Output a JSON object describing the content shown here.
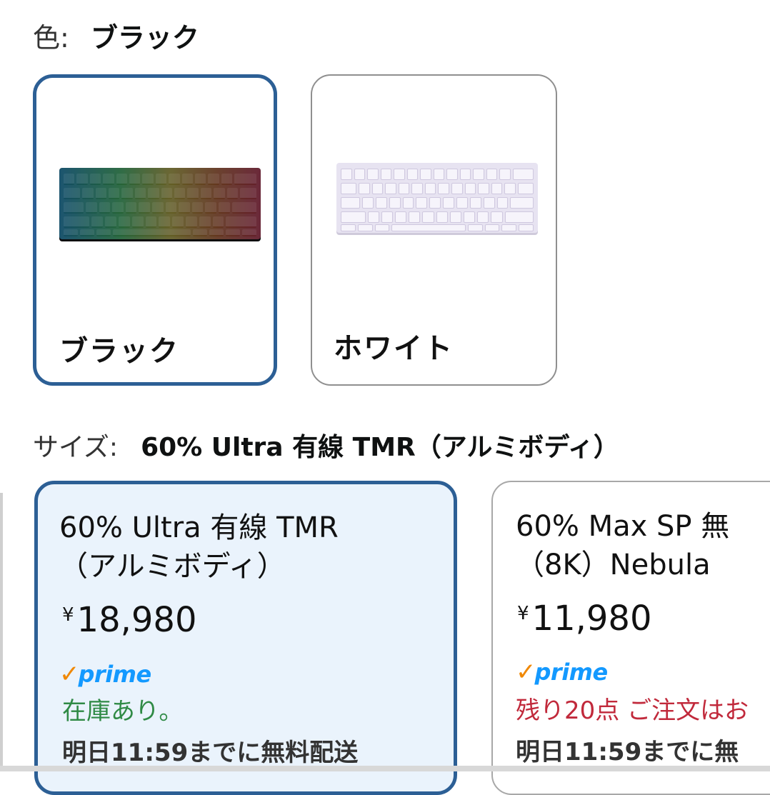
{
  "color_selector": {
    "label": "色:",
    "selected_value": "ブラック",
    "options": [
      {
        "name": "ブラック",
        "selected": true
      },
      {
        "name": "ホワイト",
        "selected": false
      }
    ]
  },
  "size_selector": {
    "label": "サイズ:",
    "selected_value": "60% Ultra 有線 TMR（アルミボディ）",
    "options": [
      {
        "title_line1": "60% Ultra 有線 TMR",
        "title_line2": "（アルミボディ）",
        "price_symbol": "¥",
        "price": "18,980",
        "prime": "prime",
        "stock": "在庫あり。",
        "delivery": "明日11:59までに無料配送",
        "selected": true
      },
      {
        "title_line1": "60% Max SP 無",
        "title_line2": "（8K）Nebula",
        "price_symbol": "¥",
        "price": "11,980",
        "prime": "prime",
        "stock": "残り20点 ご注文はお",
        "delivery": "明日11:59までに無",
        "selected": false
      }
    ]
  },
  "colors": {
    "selected_border": "#2c5f95",
    "selected_card_bg": "#eaf3fc",
    "prime_blue": "#1399ff",
    "prime_check": "#f08804",
    "in_stock": "#2f8a45",
    "low_stock": "#c1293b"
  }
}
